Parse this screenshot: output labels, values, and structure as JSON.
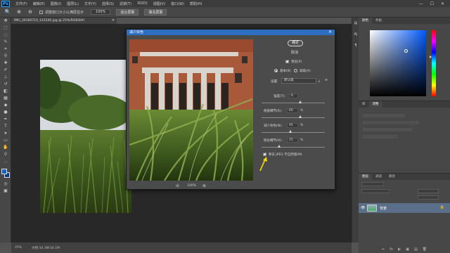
{
  "app": {
    "logo": "Ps"
  },
  "menu": [
    "文件(F)",
    "编辑(E)",
    "图像(I)",
    "图层(L)",
    "文字(Y)",
    "选择(S)",
    "滤镜(T)",
    "3D(D)",
    "视图(V)",
    "窗口(W)",
    "帮助(H)"
  ],
  "window_controls": [
    "—",
    "☐",
    "✕"
  ],
  "options": {
    "resize_windows_label": "调整窗口大小以满屏显示",
    "zoom_value": "100%",
    "fit_screen": "适合屏幕",
    "fill_screen": "填充屏幕"
  },
  "document_tab": {
    "title": "IMG_20160723_141540.jpg @ 25%(RGB/8#)",
    "close": "×"
  },
  "statusbar": {
    "zoom": "25%",
    "doc_info": "文档:34.1M/34.1M"
  },
  "dialog": {
    "title": "减少杂色",
    "close": "✕",
    "ok": "确定",
    "cancel": "取消",
    "preview_label": "预览(P)",
    "basic_label": "基本(B)",
    "advanced_label": "高级(A)",
    "settings_label": "设置:",
    "settings_value": "默认值",
    "strength_label": "强度(T):",
    "strength_value": "6",
    "preserve_label": "保留细节(R):",
    "preserve_value": "60",
    "reduce_color_label": "减少杂色(N):",
    "reduce_color_value": "45",
    "sharpen_label": "锐化细节(H):",
    "sharpen_value": "25",
    "pct": "%",
    "jpeg_label": "移去 JPEG 不自然感(M)",
    "zoom_out": "⊖",
    "zoom_value": "100%",
    "zoom_in": "⊕",
    "accent_color": "#2f6fc2",
    "arrow_color": "#f5d800"
  },
  "sliders": {
    "strength": 0.6,
    "preserve": 0.6,
    "reduce_color": 0.45,
    "sharpen": 0.25
  },
  "panels": {
    "color_tabs": [
      "颜色",
      "色板"
    ],
    "adjust_tabs": [
      "库",
      "调整"
    ],
    "layers_tabs": [
      "图层",
      "通道",
      "路径"
    ],
    "layer_name": "背景",
    "footer_icons": [
      "⇔",
      "fx",
      "◐",
      "▣",
      "▤",
      "🗑"
    ]
  }
}
